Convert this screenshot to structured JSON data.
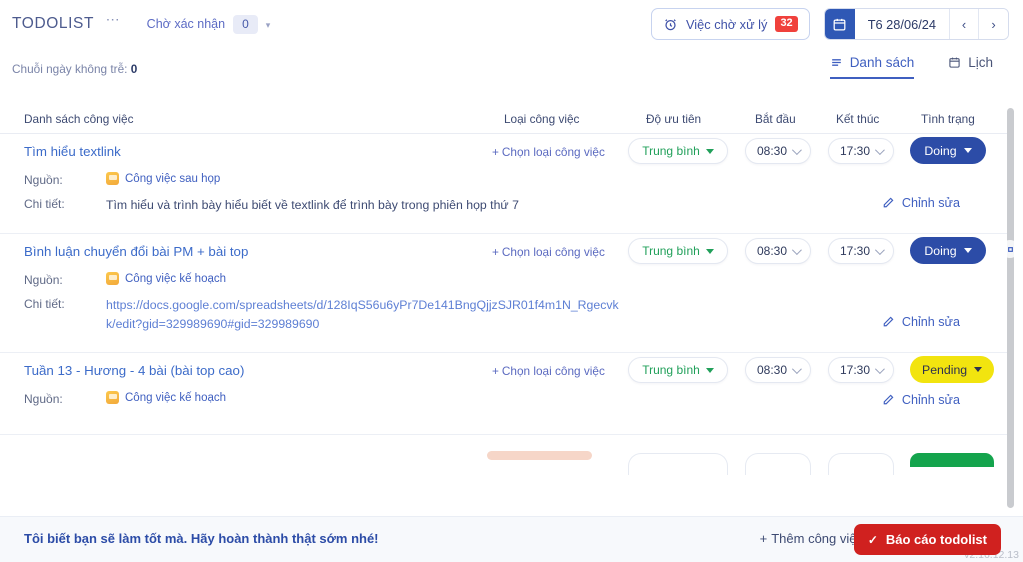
{
  "app": {
    "brand": "TODOLIST",
    "brand_menu_icon": "ellipsis-icon",
    "version": "v2.16.12.13"
  },
  "header": {
    "pending_confirm_label": "Chờ xác nhận",
    "pending_confirm_count": "0",
    "waiting_tasks_label": "Việc chờ xử lý",
    "waiting_tasks_count": "32",
    "waiting_icon": "alarm-clock-icon",
    "date_icon": "calendar-icon",
    "date_value": "T6 28/06/24",
    "prev_label": "‹",
    "next_label": "›"
  },
  "subheader": {
    "streak_label": "Chuỗi ngày không trễ:",
    "streak_value": "0",
    "tabs": [
      {
        "label": "Danh sách",
        "icon": "list-icon",
        "active": true
      },
      {
        "label": "Lịch",
        "icon": "calendar-icon",
        "active": false
      }
    ]
  },
  "table": {
    "columns": [
      {
        "key": "task",
        "label": "Danh sách công việc"
      },
      {
        "key": "type",
        "label": "Loại công việc"
      },
      {
        "key": "priority",
        "label": "Độ ưu tiên"
      },
      {
        "key": "start",
        "label": "Bắt đầu"
      },
      {
        "key": "end",
        "label": "Kết thúc"
      },
      {
        "key": "status",
        "label": "Tình trạng"
      }
    ],
    "labels": {
      "source": "Nguồn:",
      "detail": "Chi tiết:",
      "choose_type": "Chọn loại công việc",
      "edit": "Chỉnh sửa",
      "plus": "+",
      "pencil_icon": "pencil-icon"
    },
    "rows": [
      {
        "title": "Tìm hiểu textlink",
        "type_placeholder": "Chọn loại công việc",
        "priority": "Trung bình",
        "start": "08:30",
        "end": "17:30",
        "status": "Doing",
        "status_kind": "doing",
        "source": "Công việc sau họp",
        "source_icon": "folder-icon",
        "detail": "Tìm hiểu và trình bày hiểu biết về textlink để trình bày trong phiên họp thứ 7",
        "detail_is_link": false,
        "edit": "Chỉnh sửa"
      },
      {
        "title": "Bình luận chuyển đổi bài PM + bài top",
        "type_placeholder": "Chọn loại công việc",
        "priority": "Trung bình",
        "start": "08:30",
        "end": "17:30",
        "status": "Doing",
        "status_kind": "doing",
        "source": "Công việc kế hoạch",
        "source_icon": "folder-icon",
        "detail": "https://docs.google.com/spreadsheets/d/128IqS56u6yPr7De141BngQjjzSJR01f4m1N_Rgecvkk/edit?gid=329989690#gid=329989690",
        "detail_is_link": true,
        "edit": "Chỉnh sửa"
      },
      {
        "title": "Tuần 13 - Hương - 4 bài (bài top cao)",
        "type_placeholder": "Chọn loại công việc",
        "priority": "Trung bình",
        "start": "08:30",
        "end": "17:30",
        "status": "Pending",
        "status_kind": "pending",
        "source": "Công việc kế hoạch",
        "source_icon": "folder-icon",
        "detail": "",
        "detail_is_link": false,
        "edit": "Chỉnh sửa"
      }
    ]
  },
  "footer": {
    "encourage": "Tôi biết bạn sẽ làm tốt mà. Hãy hoàn thành thật sớm nhé!",
    "add_task_label": "Thêm công việc",
    "add_task_plus": "+",
    "report_label": "Báo cáo todolist",
    "report_icon": "check-icon"
  },
  "colors": {
    "brand_blue": "#2c4ca7",
    "link_blue": "#3c6bc9",
    "accent_red": "#d0211f",
    "badge_red": "#f0413c",
    "status_pending": "#f2e40f",
    "status_done": "#14a44d",
    "priority_green": "#21a05a"
  },
  "scrollbar": {
    "gear_icon": "gear-icon"
  }
}
